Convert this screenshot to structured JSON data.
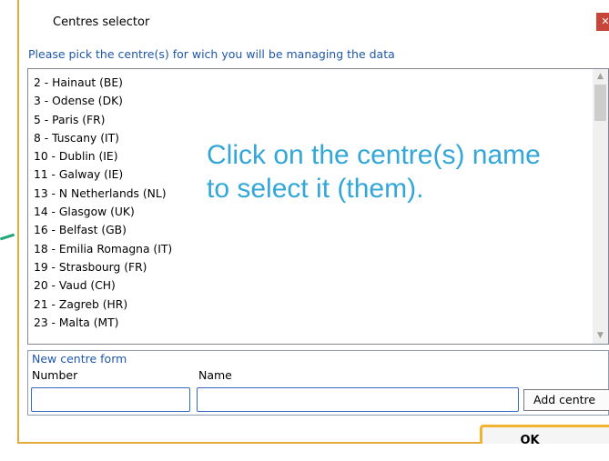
{
  "dialog": {
    "title": "Centres selector",
    "close_icon": "close-icon",
    "instruction": "Please pick the centre(s) for wich you will be managing the data"
  },
  "centres": [
    "2 - Hainaut (BE)",
    "3 - Odense (DK)",
    "5 - Paris (FR)",
    "8 - Tuscany (IT)",
    "10 - Dublin (IE)",
    "11 - Galway (IE)",
    "13 - N Netherlands (NL)",
    "14 - Glasgow (UK)",
    "16 - Belfast (GB)",
    "18 - Emilia Romagna (IT)",
    "19 - Strasbourg (FR)",
    "20 - Vaud (CH)",
    "21 - Zagreb (HR)",
    "23 - Malta (MT)"
  ],
  "annotation": "Click on the centre(s) name to select it (them).",
  "form": {
    "title": "New centre form",
    "number_label": "Number",
    "name_label": "Name",
    "number_value": "",
    "name_value": "",
    "add_button": "Add centre"
  },
  "ok_button": "OK",
  "colors": {
    "highlight": "#f0b430",
    "link_text": "#1f57a9",
    "annotation_text": "#33a7d8"
  }
}
